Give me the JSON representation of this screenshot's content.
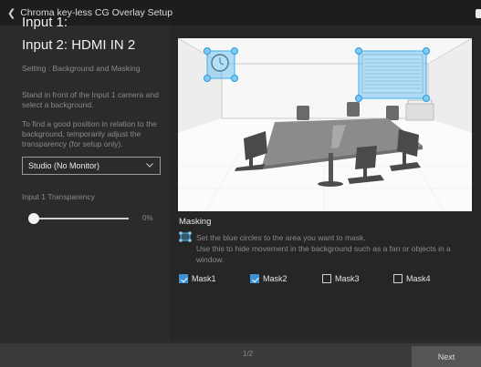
{
  "window": {
    "title": "Chroma key-less CG Overlay Setup"
  },
  "left_panel": {
    "input1_label": "Input 1:",
    "input2_label": "Input 2: HDMI IN 2",
    "setting_label": "Setting : Background and Masking",
    "instruction_1": "Stand in front of the Input 1 camera and select a background.",
    "instruction_2": "To find a good position in relation to the background, temporarily adjust the transparency (for setup only).",
    "background_select": {
      "selected": "Studio (No Monitor)"
    },
    "transparency": {
      "label": "Input 1 Transparency",
      "value_text": "0%",
      "value": 0
    }
  },
  "masking": {
    "title": "Masking",
    "description_line1": "Set the blue circles to the area you want to mask.",
    "description_line2": "Use this to hide movement in the background such as a fan or objects in a window.",
    "masks": [
      {
        "label": "Mask1",
        "checked": true
      },
      {
        "label": "Mask2",
        "checked": true
      },
      {
        "label": "Mask3",
        "checked": false
      },
      {
        "label": "Mask4",
        "checked": false
      }
    ]
  },
  "footer": {
    "page_indicator": "1/2",
    "next_label": "Next"
  },
  "colors": {
    "accent": "#3d8fd6",
    "mask_handle": "#58b8f0",
    "background": "#2b2b2b"
  },
  "icons": {
    "back": "chevron-left-icon",
    "dropdown": "chevron-down-icon",
    "mask": "mask-region-icon"
  }
}
